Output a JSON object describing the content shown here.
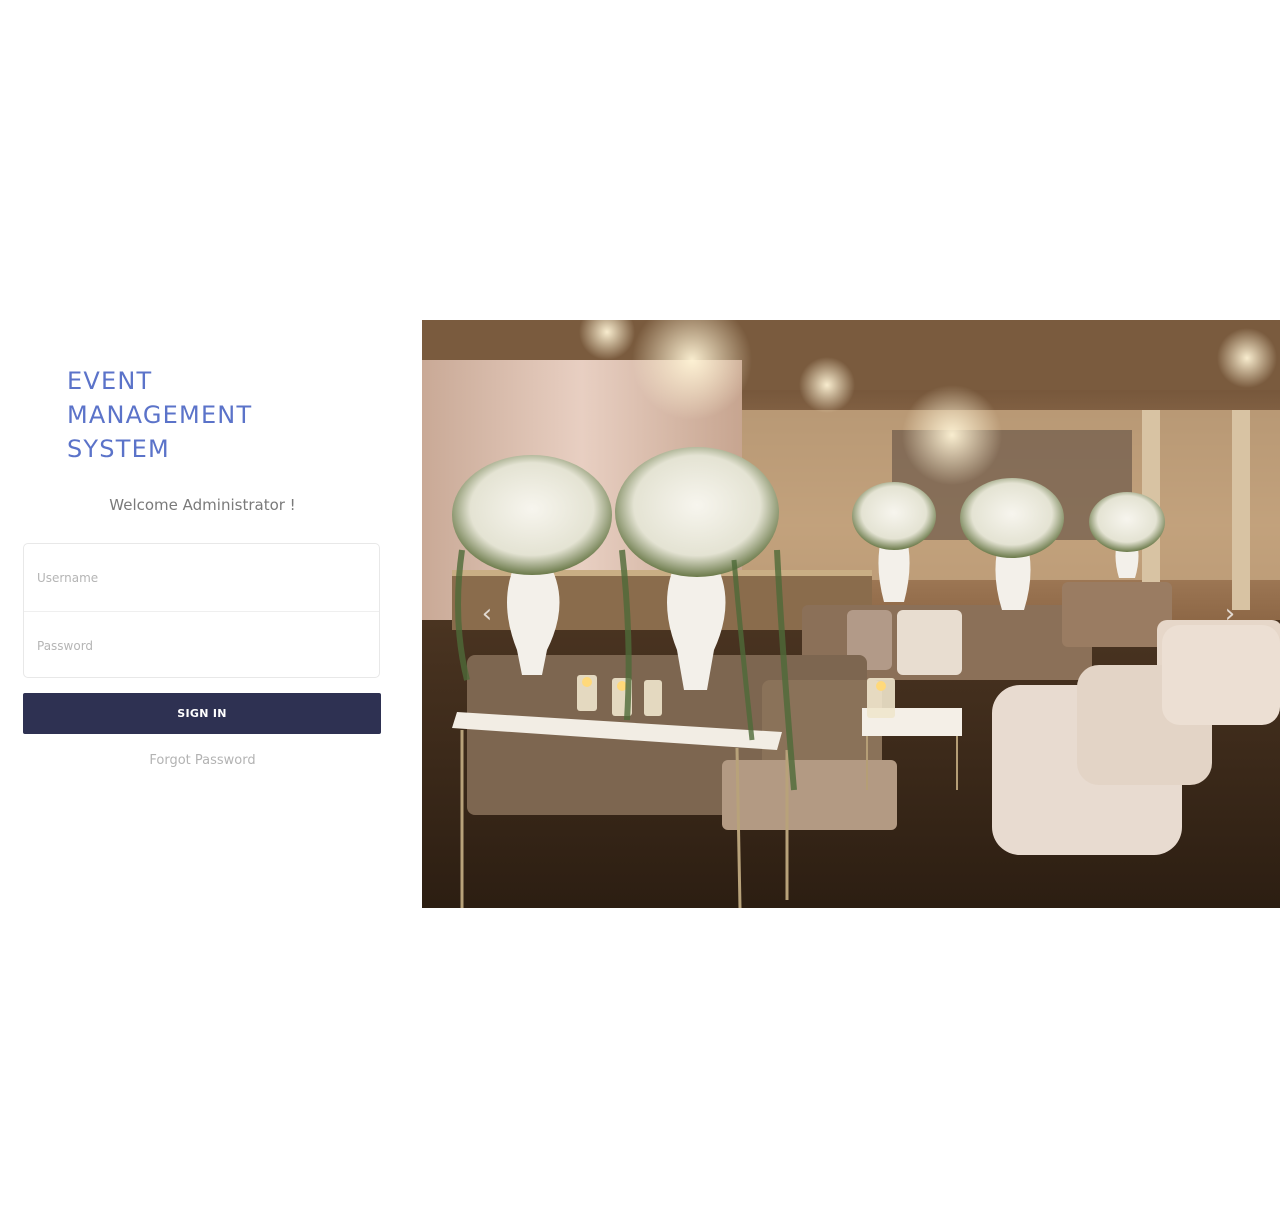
{
  "brand": {
    "title_lines": [
      "EVENT",
      "MANAGEMENT",
      "SYSTEM"
    ]
  },
  "login": {
    "welcome": "Welcome Administrator !",
    "username_placeholder": "Username",
    "password_placeholder": "Password",
    "signin_label": "SIGN IN",
    "forgot_label": "Forgot Password"
  },
  "carousel": {
    "image_subject": "banquet lounge with floral centerpieces and chandeliers",
    "prev_icon": "chevron-left-icon",
    "next_icon": "chevron-right-icon"
  },
  "colors": {
    "brand": "#5b73c9",
    "button": "#2e3152"
  }
}
